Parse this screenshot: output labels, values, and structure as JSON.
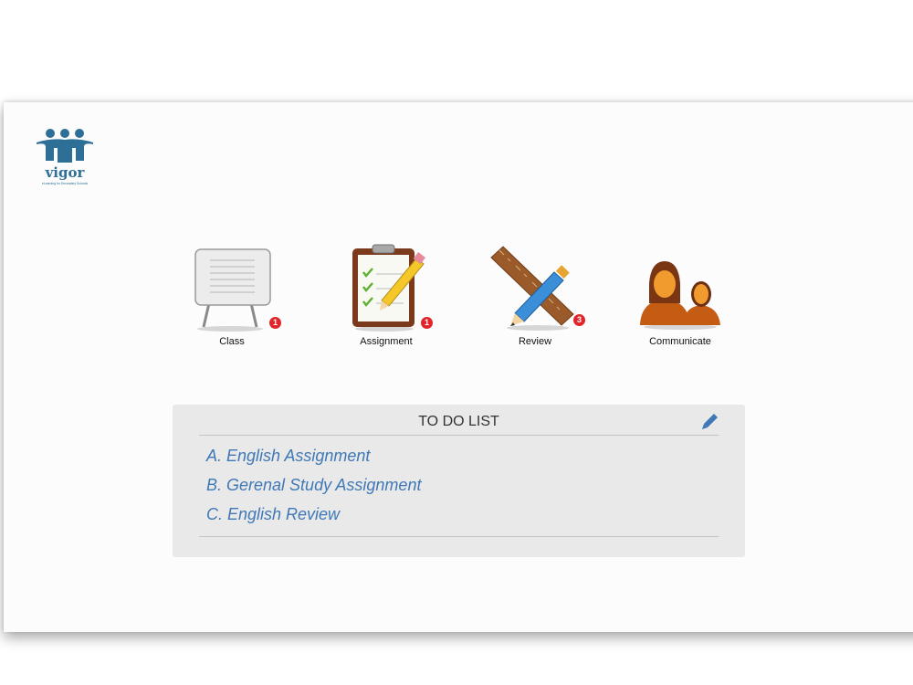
{
  "brand": {
    "name": "vigor",
    "tagline": "eLearning for Secondary Schools",
    "color": "#2e6f97",
    "icon": "people-group-logo-icon"
  },
  "nav": [
    {
      "label": "Class",
      "icon": "whiteboard-icon",
      "badge": "1"
    },
    {
      "label": "Assignment",
      "icon": "clipboard-checklist-icon",
      "badge": "1"
    },
    {
      "label": "Review",
      "icon": "ruler-pencil-icon",
      "badge": "3"
    },
    {
      "label": "Communicate",
      "icon": "people-icon",
      "badge": ""
    }
  ],
  "todo": {
    "title": "TO DO LIST",
    "edit_icon": "pencil-edit-icon",
    "items": [
      {
        "label": "A. English Assignment"
      },
      {
        "label": "B. Gerenal Study Assignment"
      },
      {
        "label": "C. English Review"
      }
    ]
  },
  "colors": {
    "badge": "#e0262b",
    "link": "#3f78b6",
    "todo_bg": "#e9e9e9"
  }
}
